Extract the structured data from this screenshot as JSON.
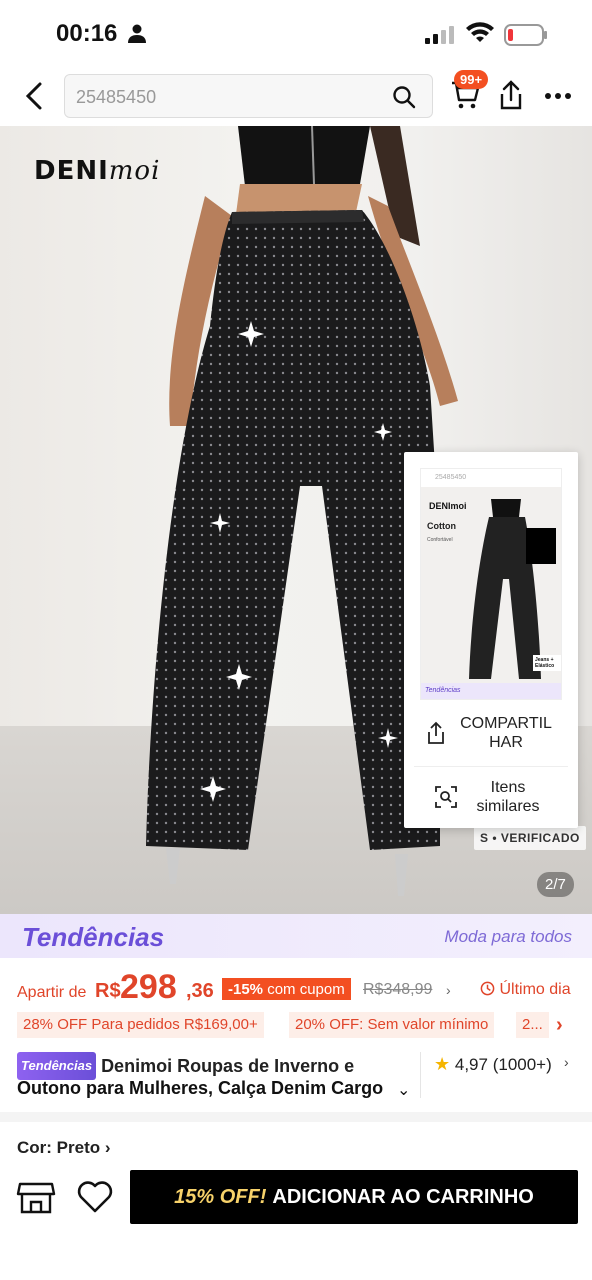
{
  "status": {
    "time": "00:16"
  },
  "search": {
    "query": "25485450"
  },
  "cart": {
    "badge": "99+"
  },
  "hero": {
    "brand_bold": "DENI",
    "brand_script": "moi",
    "counter": "2/7",
    "verified": "S • VERIFICADO"
  },
  "popup": {
    "thumb": {
      "query": "25485450",
      "brand": "DENImoi",
      "cotton": "Cotton",
      "comfort": "Confortável",
      "jeans": "Jeans + Elástico",
      "footer": "Tendências"
    },
    "share_label": "COMPARTILHAR",
    "similar_label": "Itens similares"
  },
  "trend": {
    "left": "Tendências",
    "right": "Moda para todos"
  },
  "price": {
    "from": "Apartir de",
    "currency": "R$",
    "integer": "298",
    "cents": ",36",
    "discount": "-15%",
    "discount_text": "com cupom",
    "old": "R$348,99",
    "last_day": "Último dia"
  },
  "coupons": [
    "28% OFF Para pedidos R$169,00+",
    "20% OFF: Sem valor mínimo",
    "2..."
  ],
  "product": {
    "tag": "Tendências",
    "title_line1": "Denimoi Roupas de Inverno e",
    "title_line2": "Outono para Mulheres, Calça Denim Cargo",
    "rating": "4,97",
    "reviews": "(1000+)"
  },
  "color": {
    "label": "Cor: Preto"
  },
  "actions": {
    "add_discount": "15% OFF!",
    "add_label": "ADICIONAR AO CARRINHO"
  },
  "accent_colors": {
    "orange": "#f34f21",
    "purple": "#6b4fd8",
    "price_red": "#e0452a"
  }
}
